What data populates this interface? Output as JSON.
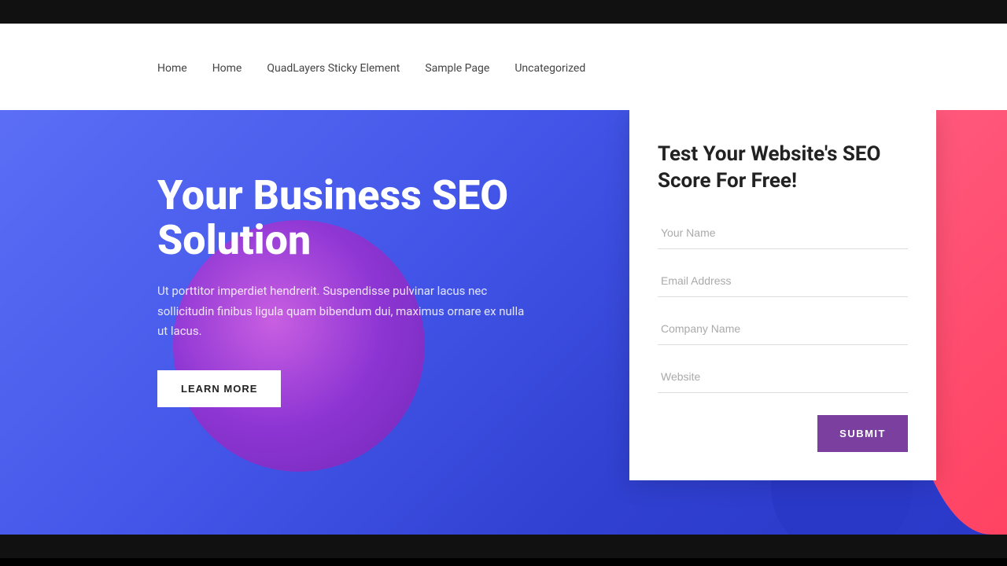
{
  "topBar": {},
  "nav": {
    "links": [
      "Home",
      "Home",
      "QuadLayers Sticky Element",
      "Sample Page",
      "Uncategorized"
    ]
  },
  "hero": {
    "title": "Your Business SEO Solution",
    "description": "Ut porttitor imperdiet hendrerit. Suspendisse pulvinar lacus nec sollicitudin finibus ligula quam bibendum dui, maximus ornare ex nulla ut lacus.",
    "cta_label": "LEARN MORE"
  },
  "form": {
    "title": "Test Your Website's SEO Score For Free!",
    "fields": [
      {
        "placeholder": "Your Name",
        "type": "text",
        "name": "your-name"
      },
      {
        "placeholder": "Email Address",
        "type": "email",
        "name": "email-address"
      },
      {
        "placeholder": "Company Name",
        "type": "text",
        "name": "company-name"
      },
      {
        "placeholder": "Website",
        "type": "url",
        "name": "website"
      }
    ],
    "submit_label": "SUBMIT"
  },
  "bottomBar": {}
}
